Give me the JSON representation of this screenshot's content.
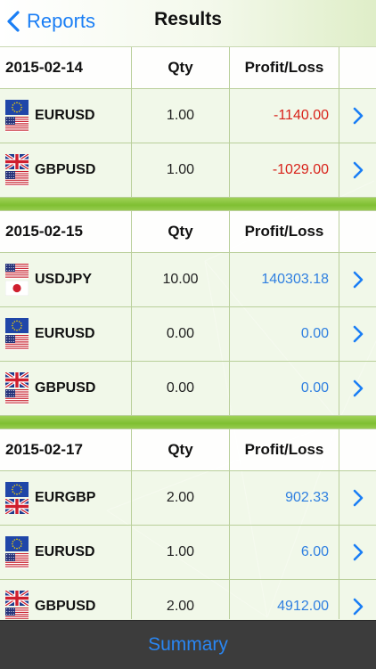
{
  "nav": {
    "back_label": "Reports",
    "title": "Results"
  },
  "table": {
    "header": {
      "qty_label": "Qty",
      "profit_label": "Profit/Loss"
    },
    "sections": [
      {
        "date": "2015-02-14",
        "rows": [
          {
            "pair": "EURUSD",
            "flags": [
              "eu-flag-icon",
              "us-flag-icon"
            ],
            "qty": "1.00",
            "pl": "-1140.00",
            "sign": "neg"
          },
          {
            "pair": "GBPUSD",
            "flags": [
              "uk-flag-icon",
              "us-flag-icon"
            ],
            "qty": "1.00",
            "pl": "-1029.00",
            "sign": "neg"
          }
        ]
      },
      {
        "date": "2015-02-15",
        "rows": [
          {
            "pair": "USDJPY",
            "flags": [
              "us-flag-icon",
              "jp-flag-icon"
            ],
            "qty": "10.00",
            "pl": "140303.18",
            "sign": "pos"
          },
          {
            "pair": "EURUSD",
            "flags": [
              "eu-flag-icon",
              "us-flag-icon"
            ],
            "qty": "0.00",
            "pl": "0.00",
            "sign": "pos"
          },
          {
            "pair": "GBPUSD",
            "flags": [
              "uk-flag-icon",
              "us-flag-icon"
            ],
            "qty": "0.00",
            "pl": "0.00",
            "sign": "pos"
          }
        ]
      },
      {
        "date": "2015-02-17",
        "rows": [
          {
            "pair": "EURGBP",
            "flags": [
              "eu-flag-icon",
              "uk-flag-icon"
            ],
            "qty": "2.00",
            "pl": "902.33",
            "sign": "pos"
          },
          {
            "pair": "EURUSD",
            "flags": [
              "eu-flag-icon",
              "us-flag-icon"
            ],
            "qty": "1.00",
            "pl": "6.00",
            "sign": "pos"
          },
          {
            "pair": "GBPUSD",
            "flags": [
              "uk-flag-icon",
              "us-flag-icon"
            ],
            "qty": "2.00",
            "pl": "4912.00",
            "sign": "pos"
          }
        ]
      }
    ]
  },
  "bottom": {
    "summary_label": "Summary"
  },
  "colors": {
    "accent": "#1a7ef5",
    "negative": "#d8221a",
    "positive": "#2f7fe0",
    "separator": "#8cc63f",
    "bottom_bar": "#3c3c3c"
  }
}
